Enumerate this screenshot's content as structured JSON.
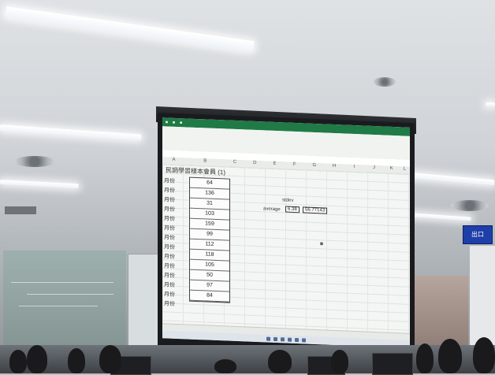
{
  "sheet": {
    "title": "民調學習樣本會員 (1)",
    "columns": [
      "A",
      "B",
      "C",
      "D",
      "E",
      "F",
      "G",
      "H",
      "I",
      "J",
      "K",
      "L"
    ],
    "row_labels": [
      "月份",
      "月份",
      "月份",
      "月份",
      "月份",
      "月份",
      "月份",
      "月份",
      "月份",
      "月份",
      "月份",
      "月份",
      "月份",
      "月份"
    ],
    "values": [
      "64",
      "136",
      "31",
      "103",
      "159",
      "99",
      "112",
      "118",
      "105",
      "50",
      "97",
      "84"
    ],
    "stat_label": "average",
    "stat_header": "stdev",
    "stat_value": "6.38",
    "stat_value2": "56.77143"
  },
  "signage": {
    "text": "出口"
  },
  "colors": {
    "excel_green": "#1f7a45",
    "sign_blue": "#1f3fa8"
  }
}
